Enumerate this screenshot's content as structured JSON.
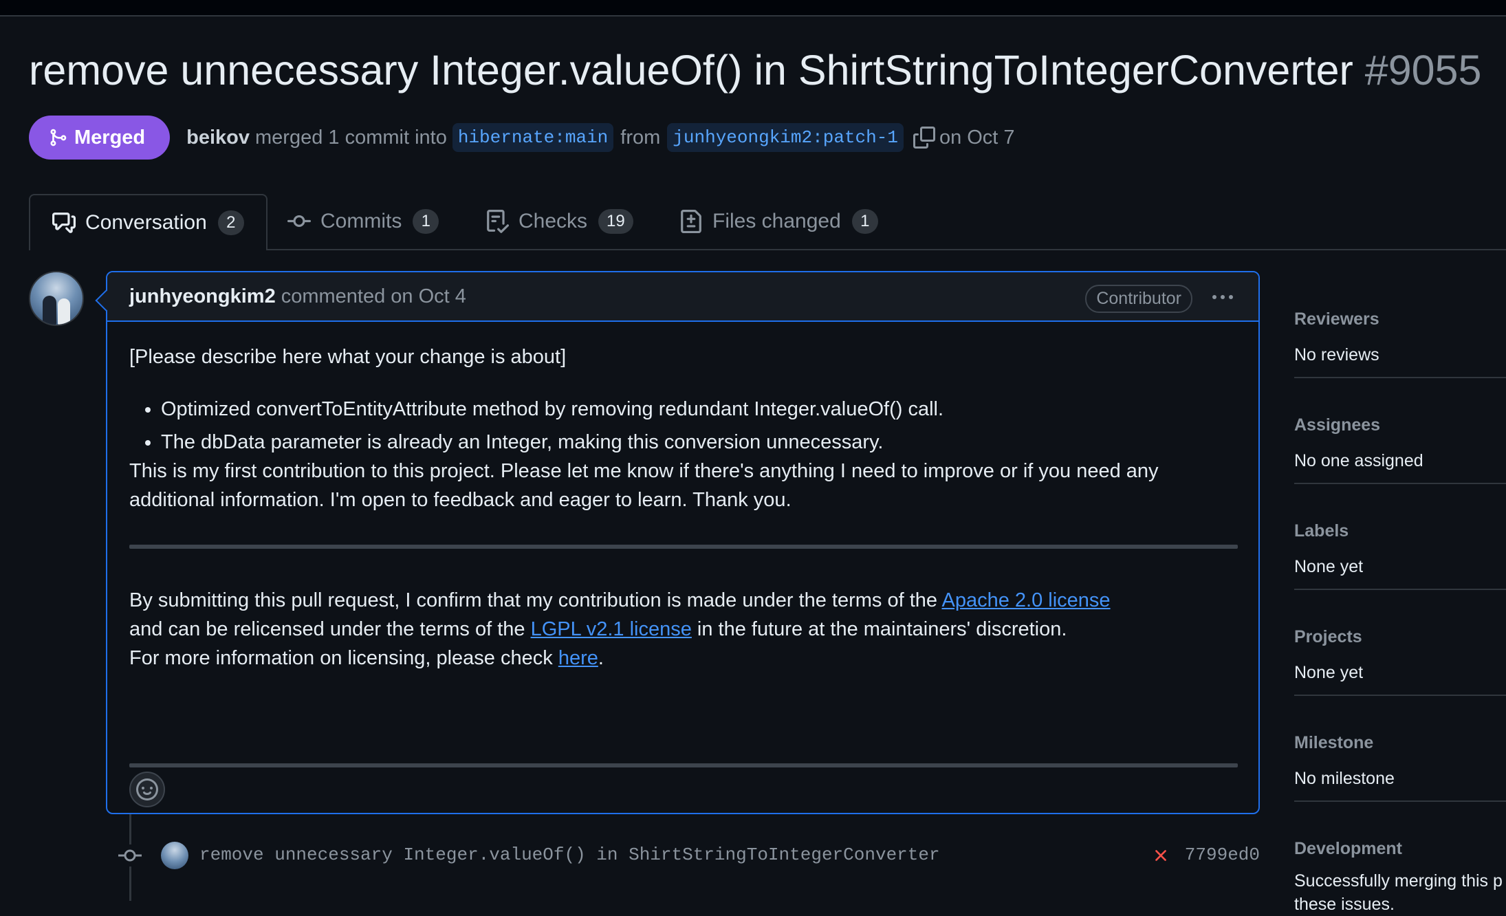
{
  "pr": {
    "title": "remove unnecessary Integer.valueOf() in ShirtStringToIntegerConverter",
    "number": "#9055",
    "status": "Merged",
    "merged_by": "beikov",
    "merge_text": "merged 1 commit into",
    "base_branch": "hibernate:main",
    "from_text": "from",
    "head_branch": "junhyeongkim2:patch-1",
    "date_text": "on Oct 7"
  },
  "tabs": [
    {
      "label": "Conversation",
      "count": "2",
      "icon": "comment-discussion-icon"
    },
    {
      "label": "Commits",
      "count": "1",
      "icon": "git-commit-icon"
    },
    {
      "label": "Checks",
      "count": "19",
      "icon": "checklist-icon"
    },
    {
      "label": "Files changed",
      "count": "1",
      "icon": "file-diff-icon"
    }
  ],
  "comment": {
    "author": "junhyeongkim2",
    "meta": "commented on Oct 4",
    "role": "Contributor",
    "p1": "[Please describe here what your change is about]",
    "bullets": [
      "Optimized convertToEntityAttribute method by removing redundant Integer.valueOf() call.",
      "The dbData parameter is already an Integer, making this conversion unnecessary."
    ],
    "p2": "This is my first contribution to this project. Please let me know if there's anything I need to improve or if you need any additional information. I'm open to feedback and eager to learn. Thank you.",
    "license": {
      "line1_a": "By submitting this pull request, I confirm that my contribution is made under the terms of the ",
      "link1": "Apache 2.0 license",
      "line2_a": "and can be relicensed under the terms of the ",
      "link2": "LGPL v2.1 license",
      "line2_b": " in the future at the maintainers' discretion.",
      "line3_a": "For more information on licensing, please check ",
      "link3": "here",
      "line3_b": "."
    }
  },
  "commit": {
    "message": "remove unnecessary Integer.valueOf() in ShirtStringToIntegerConverter",
    "sha": "7799ed0",
    "status": "failed"
  },
  "sidebar": [
    {
      "title": "Reviewers",
      "value": "No reviews"
    },
    {
      "title": "Assignees",
      "value": "No one assigned"
    },
    {
      "title": "Labels",
      "value": "None yet"
    },
    {
      "title": "Projects",
      "value": "None yet"
    },
    {
      "title": "Milestone",
      "value": "No milestone"
    },
    {
      "title": "Development",
      "value": "Successfully merging this p",
      "value2": "these issues."
    }
  ],
  "colors": {
    "background": "#0d1117",
    "merged": "#8957e5",
    "link": "#4493f8",
    "border_active": "#1f6feb",
    "fail": "#f85149"
  }
}
